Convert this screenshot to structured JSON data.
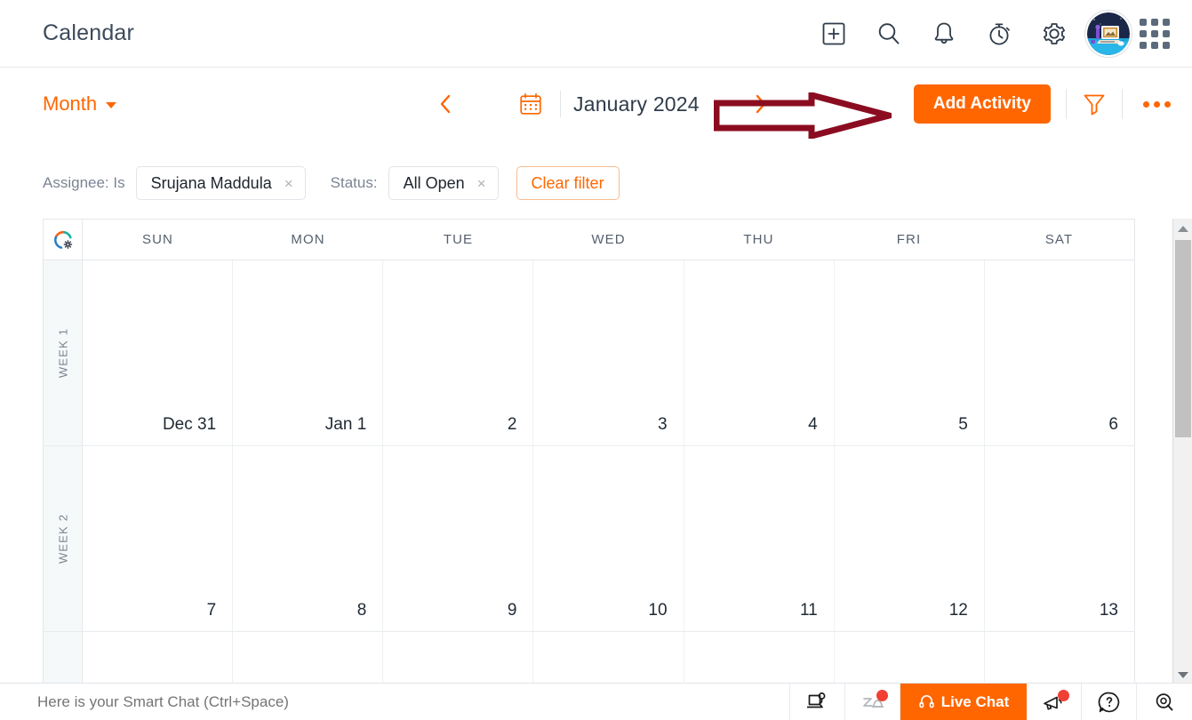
{
  "app": {
    "title": "Calendar",
    "accent_color": "#ff6600",
    "annotation_color": "#8b0c20"
  },
  "topbar": {
    "icons": [
      {
        "name": "add-box-icon",
        "label": "Add"
      },
      {
        "name": "search-icon",
        "label": "Search"
      },
      {
        "name": "notifications-bell-icon",
        "label": "Notifications"
      },
      {
        "name": "timer-clock-icon",
        "label": "Timer"
      },
      {
        "name": "settings-gear-icon",
        "label": "Settings"
      }
    ],
    "avatar_alt": "User avatar",
    "apps_grid_label": "Apps"
  },
  "toolbar": {
    "view": "Month",
    "prev_label": "Previous",
    "next_label": "Next",
    "mini_calendar_label": "Date picker",
    "month_title": "January 2024",
    "add_activity_label": "Add Activity",
    "filter_icon_label": "Filter",
    "more_label": "More options"
  },
  "filters": {
    "assignee_label": "Assignee: Is",
    "assignee_value": "Srujana Maddula",
    "status_label": "Status:",
    "status_value": "All Open",
    "clear_label": "Clear filter",
    "remove_symbol": "×"
  },
  "calendar": {
    "settings_icon_label": "Calendar settings",
    "day_headers": [
      "SUN",
      "MON",
      "TUE",
      "WED",
      "THU",
      "FRI",
      "SAT"
    ],
    "weeks": [
      {
        "label": "WEEK 1",
        "days": [
          "Dec 31",
          "Jan 1",
          "2",
          "3",
          "4",
          "5",
          "6"
        ]
      },
      {
        "label": "WEEK 2",
        "days": [
          "7",
          "8",
          "9",
          "10",
          "11",
          "12",
          "13"
        ]
      },
      {
        "label": "",
        "days": [
          "",
          "",
          "",
          "",
          "",
          "",
          ""
        ]
      }
    ]
  },
  "scrollbar": {
    "up_label": "Scroll up",
    "down_label": "Scroll down",
    "thumb_label": "Scroll thumb"
  },
  "bottombar": {
    "smart_chat_placeholder": "Here is your Smart Chat (Ctrl+Space)",
    "laptop_support_label": "Remote support",
    "zia_label": "Zia",
    "live_chat_label": "Live Chat",
    "announcements_label": "Announcements",
    "help_label": "Help",
    "explore_label": "Explore"
  }
}
